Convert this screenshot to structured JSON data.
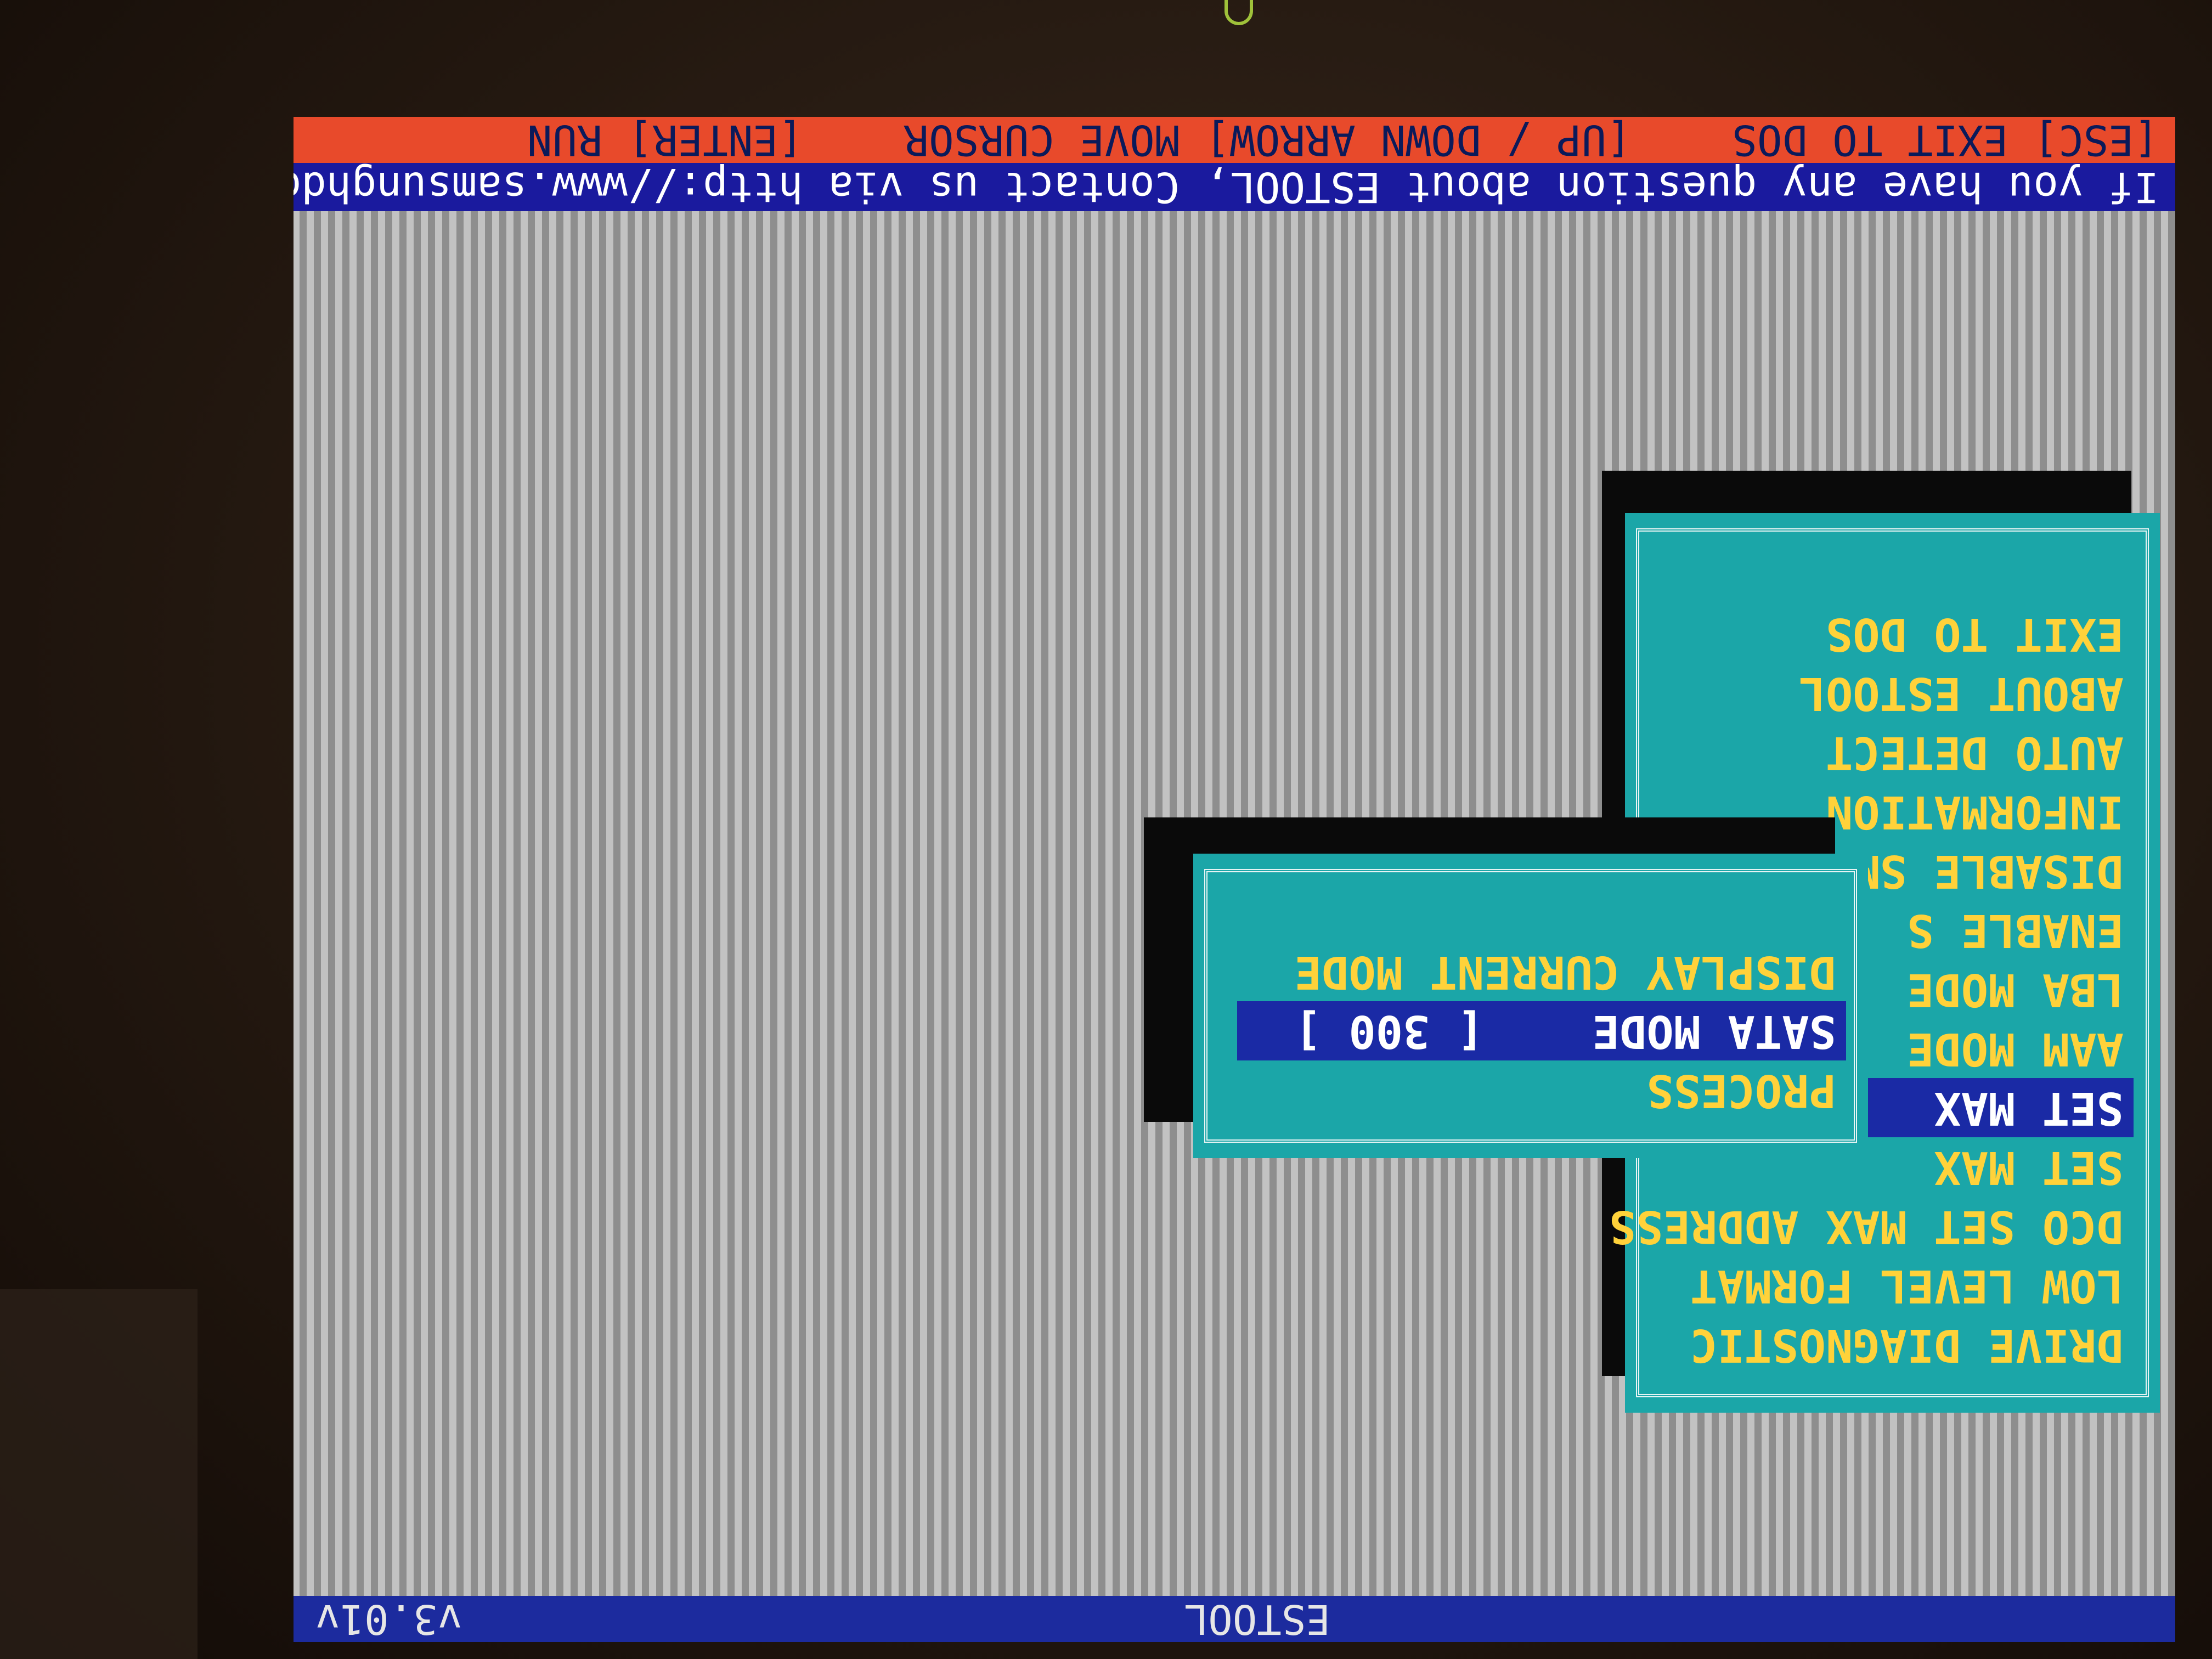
{
  "app": {
    "title": "ESTOOL",
    "version": "v3.01v"
  },
  "help_text": "If you have any question about ESTOOL, Contact us via http://www.samsunghdd.com",
  "key_hints": "[ESC] EXIT TO DOS    [UP / DOWN ARROW] MOVE CURSOR    [ENTER] RUN",
  "main_menu": {
    "items": [
      {
        "label": "DRIVE DIAGNOSTIC"
      },
      {
        "label": "LOW LEVEL FORMAT"
      },
      {
        "label": "DCO SET MAX ADDRESS"
      },
      {
        "label": "SET MAX"
      },
      {
        "label": "SET MAX"
      },
      {
        "label": "AAM MODE"
      },
      {
        "label": "LBA MODE"
      },
      {
        "label": "ENABLE S"
      },
      {
        "label": "DISABLE SM"
      },
      {
        "label": "INFORMATION"
      },
      {
        "label": "AUTO DETECT"
      },
      {
        "label": "ABOUT ESTOOL"
      },
      {
        "label": "EXIT TO DOS"
      }
    ],
    "selected_index": 4
  },
  "sub_menu": {
    "items": [
      {
        "label": "PROCESS"
      },
      {
        "label": "SATA MODE    [ 300 ]"
      },
      {
        "label": "DISPLAY CURRENT MODE"
      }
    ],
    "selected_index": 1
  },
  "colors": {
    "header_blue": "#1c2b9e",
    "key_bar_red": "#e84a2b",
    "menu_cyan": "#1ba6a8",
    "menu_text_yellow": "#ffd23a",
    "selection_blue": "#1a2aa5"
  }
}
